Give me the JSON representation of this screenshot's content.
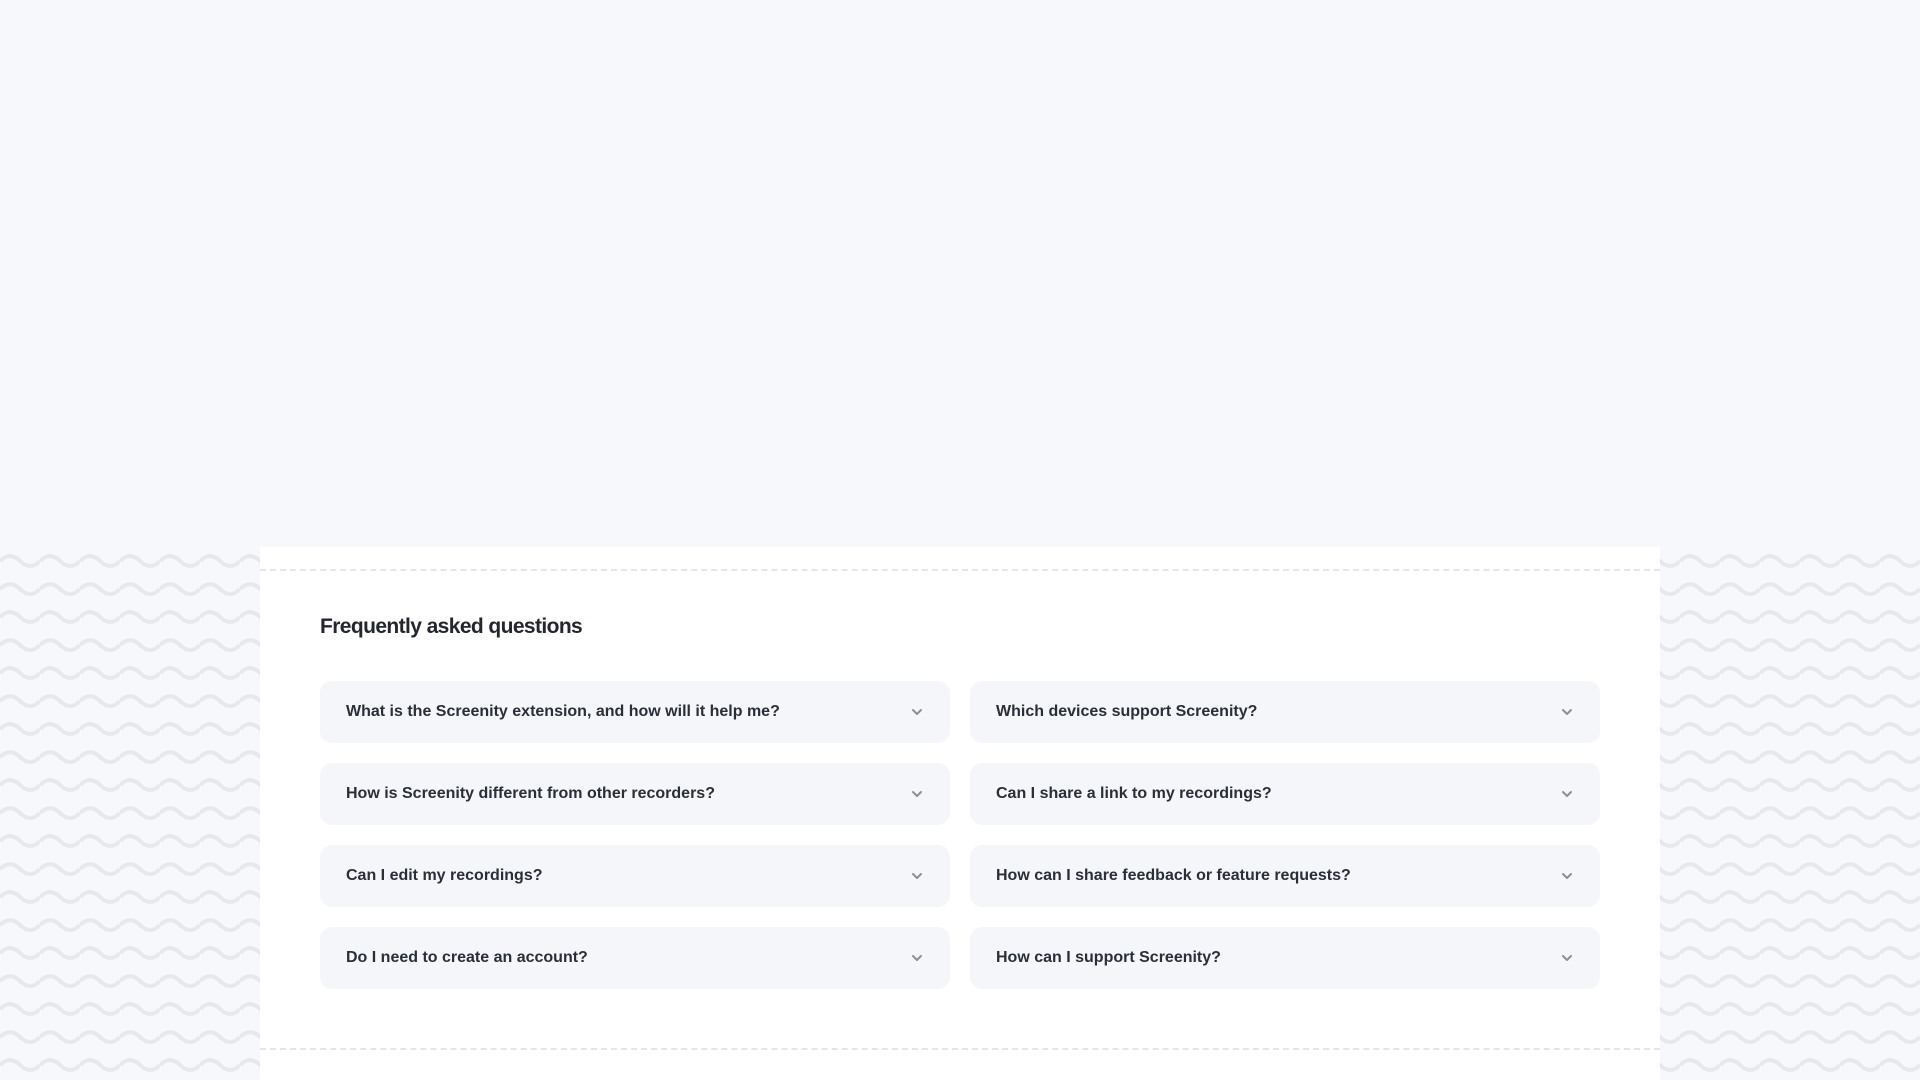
{
  "faq": {
    "title": "Frequently asked questions",
    "items": [
      {
        "question": "What is the Screenity extension, and how will it help me?",
        "icon": "chevron-down-icon"
      },
      {
        "question": "Which devices support Screenity?",
        "icon": "chevron-down-icon"
      },
      {
        "question": "How is Screenity different from other recorders?",
        "icon": "chevron-down-icon"
      },
      {
        "question": "Can I share a link to my recordings?",
        "icon": "chevron-down-icon"
      },
      {
        "question": "Can I edit my recordings?",
        "icon": "chevron-down-icon"
      },
      {
        "question": "How can I share feedback or feature requests?",
        "icon": "chevron-down-icon"
      },
      {
        "question": "Do I need to create an account?",
        "icon": "chevron-down-icon"
      },
      {
        "question": "How can I support Screenity?",
        "icon": "chevron-down-icon"
      }
    ]
  },
  "colors": {
    "page_background": "#f7f8fb",
    "card_background": "#ffffff",
    "item_background": "#f5f6f9",
    "text": "#2a2e37",
    "chevron": "#8a8f99",
    "pattern_stroke": "#e6e8ee"
  }
}
